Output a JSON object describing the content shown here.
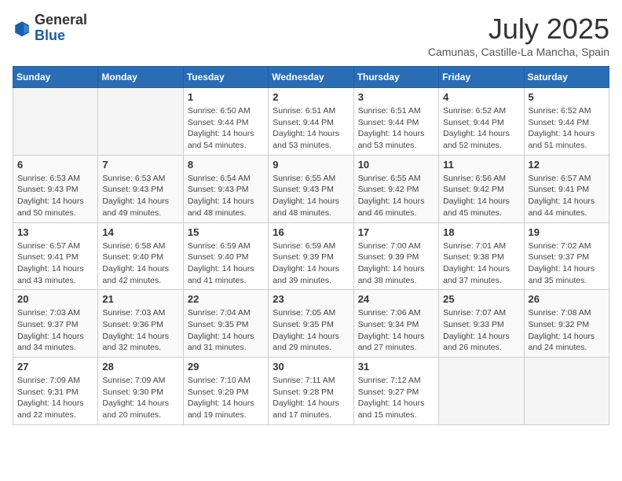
{
  "header": {
    "logo_general": "General",
    "logo_blue": "Blue",
    "month": "July 2025",
    "location": "Camunas, Castille-La Mancha, Spain"
  },
  "weekdays": [
    "Sunday",
    "Monday",
    "Tuesday",
    "Wednesday",
    "Thursday",
    "Friday",
    "Saturday"
  ],
  "weeks": [
    [
      {
        "day": "",
        "info": ""
      },
      {
        "day": "",
        "info": ""
      },
      {
        "day": "1",
        "info": "Sunrise: 6:50 AM\nSunset: 9:44 PM\nDaylight: 14 hours and 54 minutes."
      },
      {
        "day": "2",
        "info": "Sunrise: 6:51 AM\nSunset: 9:44 PM\nDaylight: 14 hours and 53 minutes."
      },
      {
        "day": "3",
        "info": "Sunrise: 6:51 AM\nSunset: 9:44 PM\nDaylight: 14 hours and 53 minutes."
      },
      {
        "day": "4",
        "info": "Sunrise: 6:52 AM\nSunset: 9:44 PM\nDaylight: 14 hours and 52 minutes."
      },
      {
        "day": "5",
        "info": "Sunrise: 6:52 AM\nSunset: 9:44 PM\nDaylight: 14 hours and 51 minutes."
      }
    ],
    [
      {
        "day": "6",
        "info": "Sunrise: 6:53 AM\nSunset: 9:43 PM\nDaylight: 14 hours and 50 minutes."
      },
      {
        "day": "7",
        "info": "Sunrise: 6:53 AM\nSunset: 9:43 PM\nDaylight: 14 hours and 49 minutes."
      },
      {
        "day": "8",
        "info": "Sunrise: 6:54 AM\nSunset: 9:43 PM\nDaylight: 14 hours and 48 minutes."
      },
      {
        "day": "9",
        "info": "Sunrise: 6:55 AM\nSunset: 9:43 PM\nDaylight: 14 hours and 48 minutes."
      },
      {
        "day": "10",
        "info": "Sunrise: 6:55 AM\nSunset: 9:42 PM\nDaylight: 14 hours and 46 minutes."
      },
      {
        "day": "11",
        "info": "Sunrise: 6:56 AM\nSunset: 9:42 PM\nDaylight: 14 hours and 45 minutes."
      },
      {
        "day": "12",
        "info": "Sunrise: 6:57 AM\nSunset: 9:41 PM\nDaylight: 14 hours and 44 minutes."
      }
    ],
    [
      {
        "day": "13",
        "info": "Sunrise: 6:57 AM\nSunset: 9:41 PM\nDaylight: 14 hours and 43 minutes."
      },
      {
        "day": "14",
        "info": "Sunrise: 6:58 AM\nSunset: 9:40 PM\nDaylight: 14 hours and 42 minutes."
      },
      {
        "day": "15",
        "info": "Sunrise: 6:59 AM\nSunset: 9:40 PM\nDaylight: 14 hours and 41 minutes."
      },
      {
        "day": "16",
        "info": "Sunrise: 6:59 AM\nSunset: 9:39 PM\nDaylight: 14 hours and 39 minutes."
      },
      {
        "day": "17",
        "info": "Sunrise: 7:00 AM\nSunset: 9:39 PM\nDaylight: 14 hours and 38 minutes."
      },
      {
        "day": "18",
        "info": "Sunrise: 7:01 AM\nSunset: 9:38 PM\nDaylight: 14 hours and 37 minutes."
      },
      {
        "day": "19",
        "info": "Sunrise: 7:02 AM\nSunset: 9:37 PM\nDaylight: 14 hours and 35 minutes."
      }
    ],
    [
      {
        "day": "20",
        "info": "Sunrise: 7:03 AM\nSunset: 9:37 PM\nDaylight: 14 hours and 34 minutes."
      },
      {
        "day": "21",
        "info": "Sunrise: 7:03 AM\nSunset: 9:36 PM\nDaylight: 14 hours and 32 minutes."
      },
      {
        "day": "22",
        "info": "Sunrise: 7:04 AM\nSunset: 9:35 PM\nDaylight: 14 hours and 31 minutes."
      },
      {
        "day": "23",
        "info": "Sunrise: 7:05 AM\nSunset: 9:35 PM\nDaylight: 14 hours and 29 minutes."
      },
      {
        "day": "24",
        "info": "Sunrise: 7:06 AM\nSunset: 9:34 PM\nDaylight: 14 hours and 27 minutes."
      },
      {
        "day": "25",
        "info": "Sunrise: 7:07 AM\nSunset: 9:33 PM\nDaylight: 14 hours and 26 minutes."
      },
      {
        "day": "26",
        "info": "Sunrise: 7:08 AM\nSunset: 9:32 PM\nDaylight: 14 hours and 24 minutes."
      }
    ],
    [
      {
        "day": "27",
        "info": "Sunrise: 7:09 AM\nSunset: 9:31 PM\nDaylight: 14 hours and 22 minutes."
      },
      {
        "day": "28",
        "info": "Sunrise: 7:09 AM\nSunset: 9:30 PM\nDaylight: 14 hours and 20 minutes."
      },
      {
        "day": "29",
        "info": "Sunrise: 7:10 AM\nSunset: 9:29 PM\nDaylight: 14 hours and 19 minutes."
      },
      {
        "day": "30",
        "info": "Sunrise: 7:11 AM\nSunset: 9:28 PM\nDaylight: 14 hours and 17 minutes."
      },
      {
        "day": "31",
        "info": "Sunrise: 7:12 AM\nSunset: 9:27 PM\nDaylight: 14 hours and 15 minutes."
      },
      {
        "day": "",
        "info": ""
      },
      {
        "day": "",
        "info": ""
      }
    ]
  ]
}
